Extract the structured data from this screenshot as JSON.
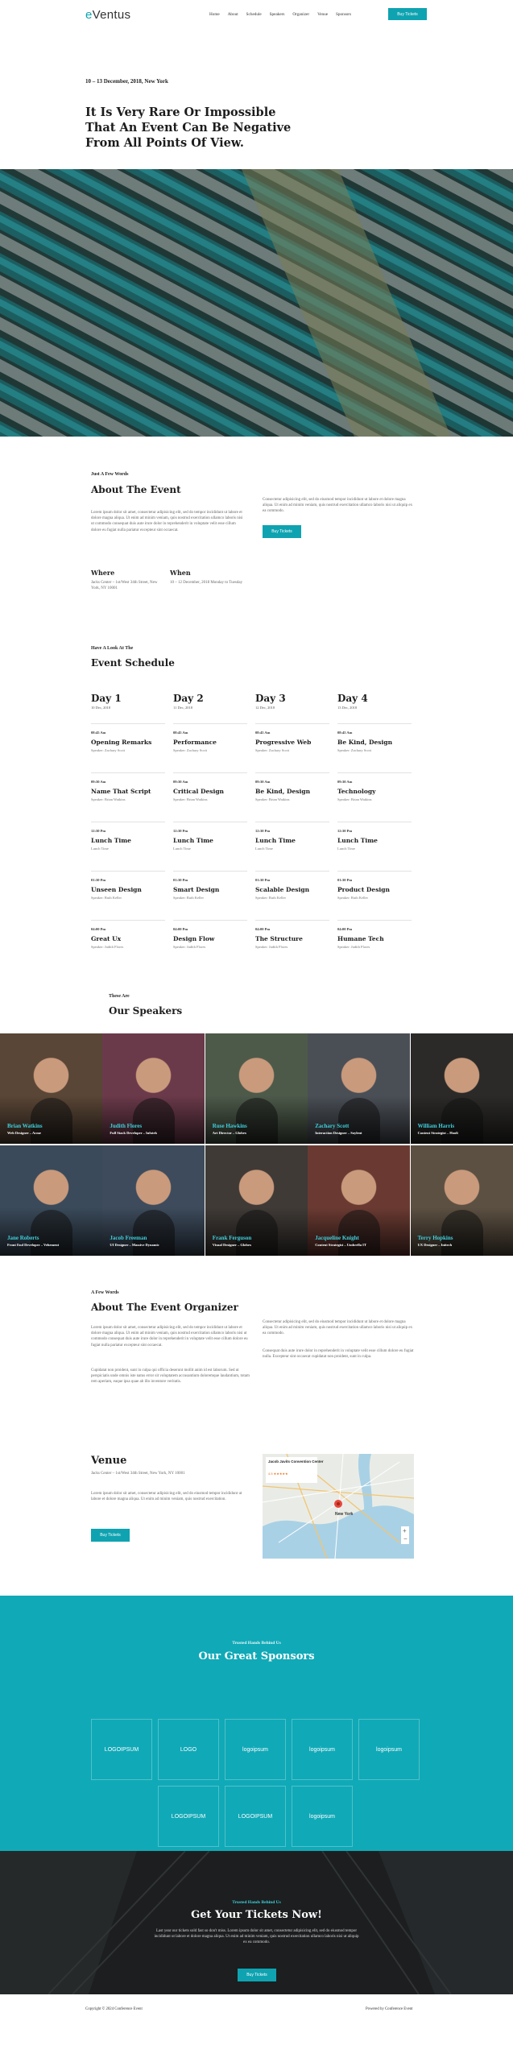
{
  "header": {
    "logo": "eVentus",
    "nav": [
      "Home",
      "About",
      "Schedule",
      "Speakers",
      "Organizer",
      "Venue",
      "Sponsors"
    ],
    "cta": "Buy Tickets"
  },
  "hero": {
    "date": "10 – 13 December, 2018, New York",
    "title": "It Is Very Rare Or Impossible That An Event Can Be Negative From All Points Of View."
  },
  "about": {
    "kicker": "Just A Few Words",
    "title": "About The Event",
    "left_text": "Lorem ipsum dolor sit amet, consectetur adipisicing elit, sed do tempor incididunt ut labore et dolore magna aliqua. Ut enim ad minim veniam, quis nostrud exercitation ullamco laboris nisi ut commodo consequat duis aute irure dolor in reprehenderit in voluptate velit esse cillum dolore eu fugiat nulla pariatur excepteur sint occaecat.",
    "right_text": "Consectetur adipisicing elit, sed do eiusmod tempor incididunt ut labore et dolore magna aliqua. Ut enim ad minim veniam, quis nostrud exercitation ullamco laboris nisi ut aliquip ex ea commodo.",
    "button": "Buy Tickets",
    "where_label": "Where",
    "where_text": "Jacks Center – 1st/West 34th Street, New York, NY 10001",
    "when_label": "When",
    "when_text": "10 – 12 December, 2018 Monday to Tuesday"
  },
  "schedule": {
    "kicker": "Have A Look At The",
    "title": "Event Schedule",
    "days": [
      {
        "name": "Day 1",
        "date": "10 Dec, 2018",
        "sessions": [
          {
            "time": "08:45 Am",
            "title": "Opening Remarks",
            "speaker": "Speaker: Zachary Scott"
          },
          {
            "time": "09:30 Am",
            "title": "Name That Script",
            "speaker": "Speaker: Brian Watkins"
          },
          {
            "time": "12:30 Pm",
            "title": "Lunch Time",
            "speaker": "Lunch Time"
          },
          {
            "time": "01:30 Pm",
            "title": "Unseen Design",
            "speaker": "Speaker: Ruth Keller"
          },
          {
            "time": "04:00 Pm",
            "title": "Great Ux",
            "speaker": "Speaker: Judith Flores"
          }
        ]
      },
      {
        "name": "Day 2",
        "date": "11 Dec, 2018",
        "sessions": [
          {
            "time": "08:45 Am",
            "title": "Performance",
            "speaker": "Speaker: Zachary Scott"
          },
          {
            "time": "09:30 Am",
            "title": "Critical Design",
            "speaker": "Speaker: Brian Watkins"
          },
          {
            "time": "12:30 Pm",
            "title": "Lunch Time",
            "speaker": "Lunch Time"
          },
          {
            "time": "01:30 Pm",
            "title": "Smart Design",
            "speaker": "Speaker: Ruth Keller"
          },
          {
            "time": "04:00 Pm",
            "title": "Design Flow",
            "speaker": "Speaker: Judith Flores"
          }
        ]
      },
      {
        "name": "Day 3",
        "date": "12 Dec, 2018",
        "sessions": [
          {
            "time": "08:45 Am",
            "title": "Progressive Web",
            "speaker": "Speaker: Zachary Scott"
          },
          {
            "time": "09:30 Am",
            "title": "Be Kind, Design",
            "speaker": "Speaker: Brian Watkins"
          },
          {
            "time": "12:30 Pm",
            "title": "Lunch Time",
            "speaker": "Lunch Time"
          },
          {
            "time": "01:30 Pm",
            "title": "Scalable Design",
            "speaker": "Speaker: Ruth Keller"
          },
          {
            "time": "04:00 Pm",
            "title": "The Structure",
            "speaker": "Speaker: Judith Flores"
          }
        ]
      },
      {
        "name": "Day 4",
        "date": "13 Dec, 2018",
        "sessions": [
          {
            "time": "08:45 Am",
            "title": "Be Kind, Design",
            "speaker": "Speaker: Zachary Scott"
          },
          {
            "time": "09:30 Am",
            "title": "Technology",
            "speaker": "Speaker: Brian Watkins"
          },
          {
            "time": "12:30 Pm",
            "title": "Lunch Time",
            "speaker": "Lunch Time"
          },
          {
            "time": "01:30 Pm",
            "title": "Product Design",
            "speaker": "Speaker: Ruth Keller"
          },
          {
            "time": "04:00 Pm",
            "title": "Humane Tech",
            "speaker": "Speaker: Judith Flores"
          }
        ]
      }
    ]
  },
  "speakers": {
    "kicker": "These Are",
    "title": "Our Speakers",
    "list": [
      {
        "name": "Brian Watkins",
        "role": "Web Designer – Acme",
        "color": "#5a4636"
      },
      {
        "name": "Judith Flores",
        "role": "Full Stack Developer – Infotek",
        "color": "#6b3a4a"
      },
      {
        "name": "Ruse Hawkins",
        "role": "Art Director – Globex",
        "color": "#4d5a4a"
      },
      {
        "name": "Zachary Scott",
        "role": "Interaction Designer – Soylent",
        "color": "#4a4f56"
      },
      {
        "name": "William Harris",
        "role": "Content Strategist – Hooli",
        "color": "#2b2a28"
      },
      {
        "name": "Jane Roberts",
        "role": "Front End Developer – Vehement",
        "color": "#3a4a5a"
      },
      {
        "name": "Jacob Freeman",
        "role": "UI Designer – Massive Dynamic",
        "color": "#3d4b5c"
      },
      {
        "name": "Frank Ferguson",
        "role": "Visual Designer – Globex",
        "color": "#3f3a36"
      },
      {
        "name": "Jacqueline Knight",
        "role": "Content Strategist – Umbrella IT",
        "color": "#6a3a32"
      },
      {
        "name": "Terry Hopkins",
        "role": "UX Designer – Initech",
        "color": "#5c5042"
      }
    ]
  },
  "organizer": {
    "kicker": "A Few Words",
    "title": "About The Event Organizer",
    "left_p1": "Lorem ipsum dolor sit amet, consectetur adipisicing elit, sed do tempor incididunt ut labore et dolore magna aliqua. Ut enim ad minim veniam, quis nostrud exercitation ullamco laboris nisi ut commodo consequat duis aute irure dolor in reprehenderit in voluptate velit esse cillum dolore eu fugiat nulla pariatur excepteur sint occaecat.",
    "left_p2": "Cupidatat non proident, sunt in culpa qui officia deserunt mollit anim id est laborum. Sed ut perspiciatis unde omnis iste natus error sit voluptatem accusantium doloremque laudantium, totam rem aperiam, eaque ipsa quae ab illo inventore veritatis.",
    "right_p1": "Consectetur adipisicing elit, sed do eiusmod tempor incididunt ut labore et dolore magna aliqua. Ut enim ad minim veniam, quis nostrud exercitation ullamco laboris nisi ut aliquip ex ea commodo.",
    "right_p2": "Consequat duis aute irure dolor in reprehenderit in voluptate velit esse cillum dolore eu fugiat nulla. Excepteur sint occaecat cupidatat non proident, sunt in culpa."
  },
  "venue": {
    "title": "Venue",
    "address": "Jacks Center – 1st/West 34th Street, New York, NY 10001",
    "text": "Lorem ipsum dolor sit amet, consectetur adipisicing elit, sed do eiusmod tempor incididunt ut labore et dolore magna aliqua. Ut enim ad minim veniam, quis nostrud exercitation.",
    "button": "Buy Tickets",
    "map_place": "Jacob Javits Convention Center",
    "map_rating": "4.5",
    "map_city": "New York"
  },
  "sponsors": {
    "kicker": "Trusted Hands Behind Us",
    "title": "Our Great Sponsors",
    "logos": [
      "LOGOIPSUM",
      "LOGO",
      "logoipsum",
      "logoipsum",
      "logoipsum",
      "LOGOIPSUM",
      "LOGOIPSUM",
      "logoipsum"
    ]
  },
  "tickets": {
    "kicker": "Trusted Hands Behind Us",
    "title": "Get Your Tickets Now!",
    "text": "Last year our tickets sold fast so don't miss. Lorem ipsum dolor sit amet, consectetur adipisicing elit, sed do eiusmod tempor incididunt ut labore et dolore magna aliqua. Ut enim ad minim veniam, quis nostrud exercitation ullamco laboris nisi ut aliquip ex ea commodo.",
    "button": "Buy Tickets"
  },
  "footer": {
    "copyright": "Copyright © 2024 Conference Event",
    "powered": "Powered by Conference Event"
  },
  "colors": {
    "accent": "#0fa3b1",
    "sponsor_bg": "#10a9b7",
    "dark": "#1d1d1d"
  }
}
